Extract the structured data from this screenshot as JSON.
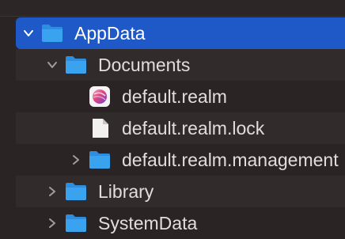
{
  "tree": {
    "items": [
      {
        "label": "AppData",
        "type": "folder",
        "expanded": true,
        "selected": true
      },
      {
        "label": "Documents",
        "type": "folder",
        "expanded": true
      },
      {
        "label": "default.realm",
        "type": "realm-file"
      },
      {
        "label": "default.realm.lock",
        "type": "document"
      },
      {
        "label": "default.realm.management",
        "type": "folder",
        "expanded": false
      },
      {
        "label": "Library",
        "type": "folder",
        "expanded": false
      },
      {
        "label": "SystemData",
        "type": "folder",
        "expanded": false
      }
    ]
  },
  "colors": {
    "background": "#2a2424",
    "stripe": "#312b2b",
    "selection": "#1f59c8",
    "folder": "#3aa3f0",
    "text": "#e2dcdc"
  },
  "icons": {
    "folder": "folder-icon",
    "realm": "realm-file-icon",
    "document": "document-icon",
    "disclosure_open": "chevron-down-icon",
    "disclosure_closed": "chevron-right-icon"
  }
}
